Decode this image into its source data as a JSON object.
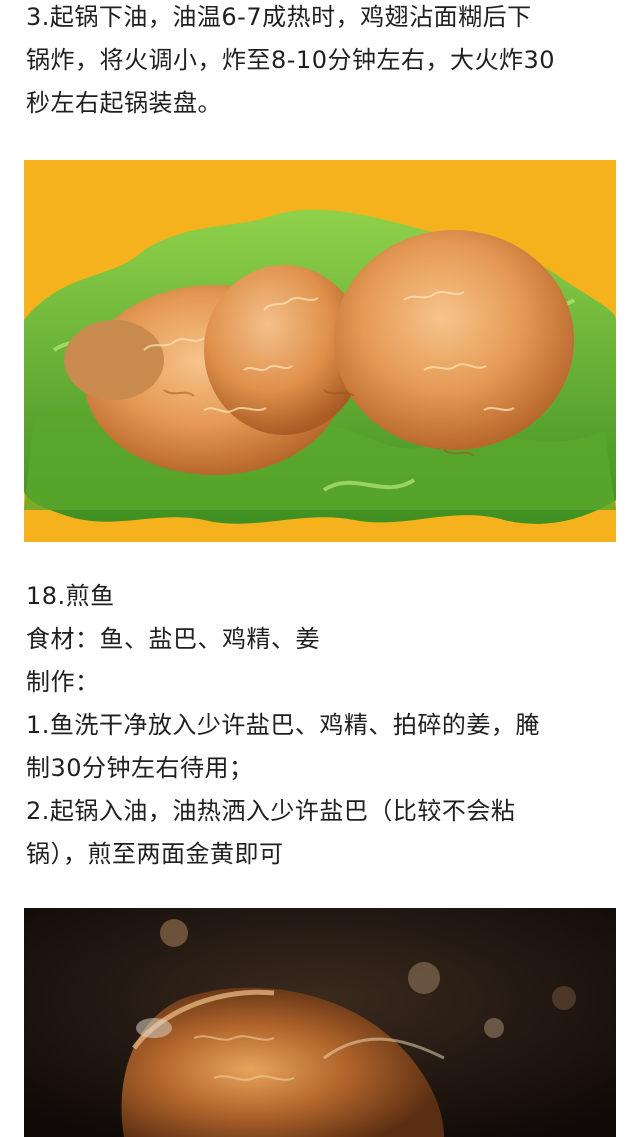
{
  "step3": {
    "lines": [
      "3.起锅下油，油温6-7成热时，鸡翅沾面糊后下",
      "锅炸，将火调小，炸至8-10分钟左右，大火炸30",
      "秒左右起锅装盘。"
    ]
  },
  "fried_chicken_photo": {
    "background_color": "#f5b21c"
  },
  "recipe18": {
    "title": "18.煎鱼",
    "ingredients": "食材：鱼、盐巴、鸡精、姜",
    "method_label": "制作：",
    "steps": [
      "1.鱼洗干净放入少许盐巴、鸡精、拍碎的姜，腌",
      "制30分钟左右待用；",
      "2.起锅入油，油热洒入少许盐巴（比较不会粘",
      "锅），煎至两面金黄即可"
    ]
  },
  "fried_fish_photo": {
    "background_color": "#1a120c"
  }
}
